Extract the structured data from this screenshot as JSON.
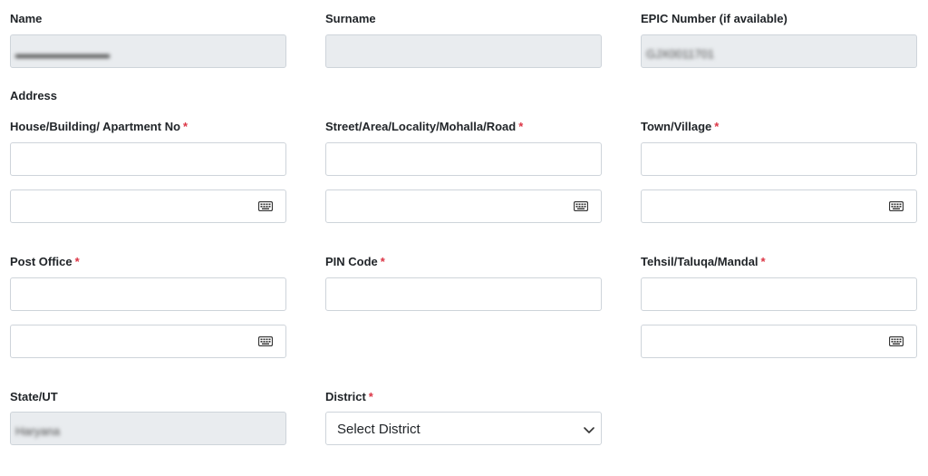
{
  "row1": {
    "name_label": "Name",
    "name_value": "▬▬▬▬▬▬▬▬",
    "surname_label": "Surname",
    "epic_label": "EPIC Number (if available)",
    "epic_value": "GJX0011701"
  },
  "address": {
    "section_label": "Address",
    "house_label": "House/Building/ Apartment No",
    "street_label": "Street/Area/Locality/Mohalla/Road",
    "town_label": "Town/Village",
    "post_office_label": "Post Office",
    "pin_label": "PIN Code",
    "tehsil_label": "Tehsil/Taluqa/Mandal",
    "required_mark": "*"
  },
  "row4": {
    "state_label": "State/UT",
    "state_value": "Haryana",
    "district_label": "District",
    "district_selected": "Select District"
  },
  "icons": {
    "keyboard": "keyboard-icon",
    "chevron": "chevron-down-icon"
  },
  "colors": {
    "required": "#dc3545",
    "disabled_bg": "#e9ecef",
    "border": "#ced4da"
  }
}
